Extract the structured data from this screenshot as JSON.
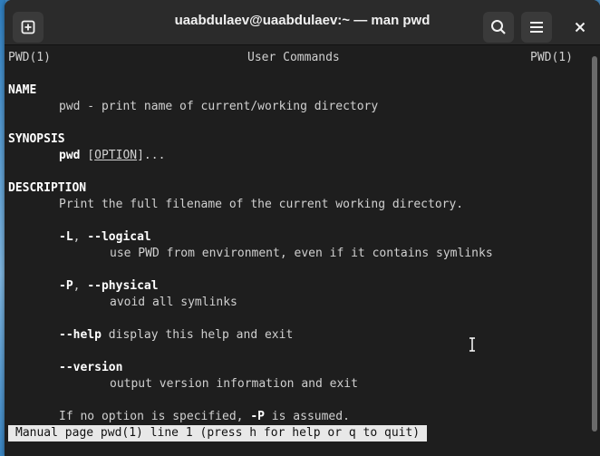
{
  "window": {
    "title": "uaabdulaev@uaabdulaev:~ — man pwd",
    "icons": [
      "new-tab-icon",
      "search-icon",
      "menu-icon",
      "close-icon"
    ]
  },
  "man": {
    "header_left": "PWD(1)",
    "header_center": "User Commands",
    "header_right": "PWD(1)",
    "sections": {
      "name_title": "NAME",
      "name_text": "pwd - print name of current/working directory",
      "synopsis_title": "SYNOPSIS",
      "synopsis_cmd": "pwd",
      "synopsis_open": " [",
      "synopsis_option": "OPTION",
      "synopsis_close": "]...",
      "description_title": "DESCRIPTION",
      "description_text": "Print the full filename of the current working directory.",
      "opt_L_short": "-L",
      "opt_L_sep": ", ",
      "opt_L_long": "--logical",
      "opt_L_desc": "use PWD from environment, even if it contains symlinks",
      "opt_P_short": "-P",
      "opt_P_sep": ", ",
      "opt_P_long": "--physical",
      "opt_P_desc": "avoid all symlinks",
      "opt_help": "--help",
      "opt_help_desc": " display this help and exit",
      "opt_version": "--version",
      "opt_version_desc": "output version information and exit",
      "default_text_a": "If no option is specified, ",
      "default_text_b": "-P",
      "default_text_c": " is assumed."
    }
  },
  "status": {
    "text": "Manual page pwd(1) line 1 (press h for help or q to quit)"
  }
}
